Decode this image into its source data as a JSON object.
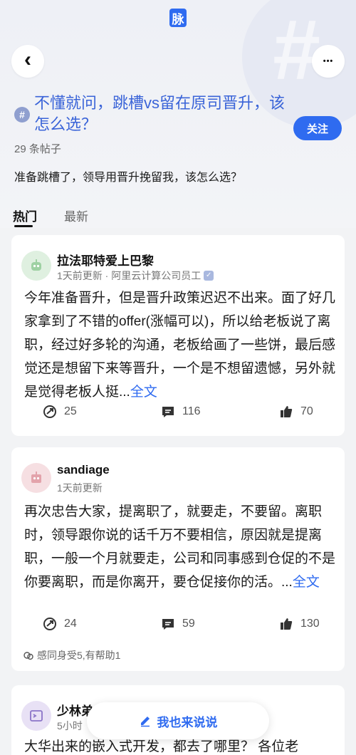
{
  "app": {
    "logo_char": "脉",
    "accent": "#2f6bf0"
  },
  "header": {
    "back_icon": "‹",
    "more_icon": "•••"
  },
  "topic": {
    "hash_symbol": "#",
    "title": "不懂就问，跳槽vs留在原司晋升，该怎么选？",
    "follow_label": "关注",
    "post_count": "29 条帖子",
    "description": "准备跳槽了，领导用晋升挽留我，该怎么选？"
  },
  "tabs": [
    {
      "label": "热门",
      "active": true
    },
    {
      "label": "最新",
      "active": false
    }
  ],
  "posts": [
    {
      "author": "拉法耶特爱上巴黎",
      "meta": "1天前更新 · 阿里云计算公司员工",
      "verified_icon": "✓",
      "text": "今年准备晋升，但是晋升政策迟迟不出来。面了好几家拿到了不错的offer(涨幅可以)，所以给老板说了离职，经过好多轮的沟通，老板给画了一些饼，最后感觉还是想留下来等晋升，一个是不想留遗憾，另外就是觉得老板人挺...",
      "full_label": "全文",
      "shares": "25",
      "comments": "116",
      "likes": "70"
    },
    {
      "author": "sandiage",
      "meta": "1天前更新",
      "text": "再次忠告大家，提离职了，就要走，不要留。离职时，领导跟你说的话千万不要相信，原因就是提离职，一般一个月就要走，公司和同事感到仓促的不是你要离职，而是你离开，要仓促接你的活。...",
      "full_label": "全文",
      "shares": "24",
      "comments": "59",
      "likes": "130",
      "reactions": "感同身受5,有帮助1"
    },
    {
      "author": "少林弟",
      "meta": "5小时",
      "text": "大华出来的嵌入式开发，都去了哪里？ 各位老"
    }
  ],
  "compose": {
    "label": "我也来说说"
  }
}
